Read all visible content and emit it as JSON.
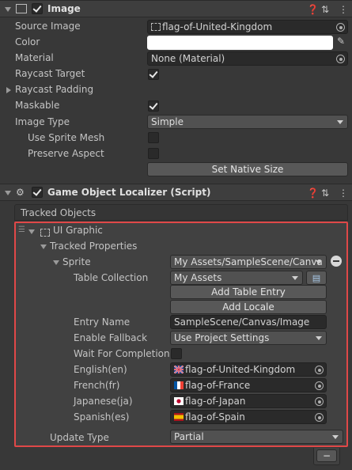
{
  "image_component": {
    "title": "Image",
    "rows": {
      "source_image": {
        "label": "Source Image",
        "value": "flag-of-United-Kingdom"
      },
      "color": {
        "label": "Color"
      },
      "material": {
        "label": "Material",
        "value": "None (Material)"
      },
      "raycast_target": {
        "label": "Raycast Target"
      },
      "raycast_padding": {
        "label": "Raycast Padding"
      },
      "maskable": {
        "label": "Maskable"
      },
      "image_type": {
        "label": "Image Type",
        "value": "Simple"
      },
      "use_sprite_mesh": {
        "label": "Use Sprite Mesh"
      },
      "preserve_aspect": {
        "label": "Preserve Aspect"
      }
    },
    "set_native_size": "Set Native Size"
  },
  "localizer_component": {
    "title": "Game Object Localizer (Script)",
    "tracked_objects": "Tracked Objects",
    "ui_graphic": "UI Graphic",
    "tracked_properties": "Tracked Properties",
    "sprite": {
      "label": "Sprite",
      "value": "My Assets/SampleScene/Canva"
    },
    "table_collection": {
      "label": "Table Collection",
      "value": "My Assets"
    },
    "add_table_entry": "Add Table Entry",
    "add_locale": "Add Locale",
    "entry_name": {
      "label": "Entry Name",
      "value": "SampleScene/Canvas/Image"
    },
    "enable_fallback": {
      "label": "Enable Fallback",
      "value": "Use Project Settings"
    },
    "wait_for_completion": {
      "label": "Wait For Completion"
    },
    "locales": [
      {
        "label": "English(en)",
        "value": "flag-of-United-Kingdom"
      },
      {
        "label": "French(fr)",
        "value": "flag-of-France"
      },
      {
        "label": "Japanese(ja)",
        "value": "flag-of-Japan"
      },
      {
        "label": "Spanish(es)",
        "value": "flag-of-Spain"
      }
    ],
    "update_type": {
      "label": "Update Type",
      "value": "Partial"
    },
    "remove_button": "−"
  },
  "colors": {
    "highlight": "#e04848",
    "background": "#383838",
    "header": "#3e3e3e"
  }
}
